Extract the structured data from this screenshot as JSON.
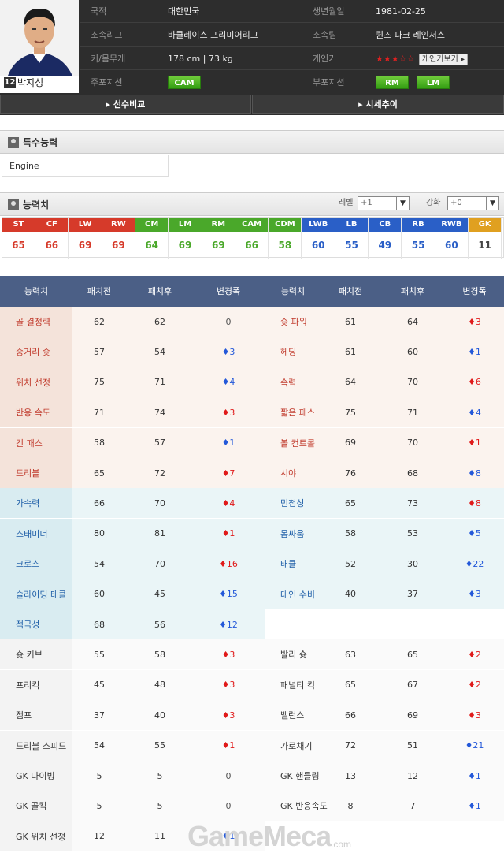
{
  "player": {
    "name": "박지성",
    "number": "12",
    "rows": [
      {
        "l1": "국적",
        "v1": "대한민국",
        "l2": "생년월일",
        "v2": "1981-02-25"
      },
      {
        "l1": "소속리그",
        "v1": "바클레이스 프리미어리그",
        "l2": "소속팀",
        "v2": "퀸즈 파크 레인저스"
      },
      {
        "l1": "키/몸무게",
        "v1": "178 cm | 73 kg",
        "l2": "개인기",
        "v2_stars": "★★★☆☆",
        "v2_btn": "개인기보기 ▸"
      },
      {
        "l1": "주포지션",
        "l2": "부포지션"
      }
    ],
    "main_positions": [
      "CAM"
    ],
    "sub_positions": [
      "RM",
      "LM"
    ]
  },
  "compare_bar": {
    "left": "▸ 선수비교",
    "right": "▸ 시세추이"
  },
  "special": {
    "title": "특수능력",
    "items": [
      "Engine"
    ]
  },
  "ability": {
    "title": "능력치",
    "level_label": "레벨",
    "level_value": "+1",
    "enhance_label": "강화",
    "enhance_value": "+0",
    "positions": [
      {
        "pos": "ST",
        "val": "65",
        "color": "#d63a2a"
      },
      {
        "pos": "CF",
        "val": "66",
        "color": "#d63a2a"
      },
      {
        "pos": "LW",
        "val": "69",
        "color": "#d63a2a"
      },
      {
        "pos": "RW",
        "val": "69",
        "color": "#d63a2a"
      },
      {
        "pos": "CM",
        "val": "64",
        "color": "#4aa82a"
      },
      {
        "pos": "LM",
        "val": "69",
        "color": "#4aa82a"
      },
      {
        "pos": "RM",
        "val": "69",
        "color": "#4aa82a"
      },
      {
        "pos": "CAM",
        "val": "66",
        "color": "#4aa82a"
      },
      {
        "pos": "CDM",
        "val": "58",
        "color": "#4aa82a"
      },
      {
        "pos": "LWB",
        "val": "60",
        "color": "#2a5fc7"
      },
      {
        "pos": "LB",
        "val": "55",
        "color": "#2a5fc7"
      },
      {
        "pos": "CB",
        "val": "49",
        "color": "#2a5fc7"
      },
      {
        "pos": "RB",
        "val": "55",
        "color": "#2a5fc7"
      },
      {
        "pos": "RWB",
        "val": "60",
        "color": "#2a5fc7"
      },
      {
        "pos": "GK",
        "val": "11",
        "color": "#e0a020"
      }
    ]
  },
  "stats": {
    "headers": [
      "능력치",
      "패치전",
      "패치후",
      "변경폭",
      "능력치",
      "패치전",
      "패치후",
      "변경폭"
    ],
    "rows": [
      {
        "g": "a",
        "n1": "골 결정력",
        "b1": "62",
        "a1": "62",
        "d1": "0",
        "n2": "슛 파워",
        "b2": "61",
        "a2": "64",
        "d2": "♦3"
      },
      {
        "g": "a",
        "n1": "중거리 슛",
        "b1": "57",
        "a1": "54",
        "d1": "♦3",
        "n2": "헤딩",
        "b2": "61",
        "a2": "60",
        "d2": "♦1"
      },
      {
        "g": "a",
        "n1": "위치 선정",
        "b1": "75",
        "a1": "71",
        "d1": "♦4",
        "n2": "속력",
        "b2": "64",
        "a2": "70",
        "d2": "♦6"
      },
      {
        "g": "a",
        "n1": "반응 속도",
        "b1": "71",
        "a1": "74",
        "d1": "♦3",
        "n2": "짧은 패스",
        "b2": "75",
        "a2": "71",
        "d2": "♦4"
      },
      {
        "g": "a",
        "n1": "긴 패스",
        "b1": "58",
        "a1": "57",
        "d1": "♦1",
        "n2": "볼 컨트롤",
        "b2": "69",
        "a2": "70",
        "d2": "♦1"
      },
      {
        "g": "a",
        "n1": "드리블",
        "b1": "65",
        "a1": "72",
        "d1": "♦7",
        "n2": "시야",
        "b2": "76",
        "a2": "68",
        "d2": "♦8"
      },
      {
        "g": "b",
        "n1": "가속력",
        "b1": "66",
        "a1": "70",
        "d1": "♦4",
        "n2": "민첩성",
        "b2": "65",
        "a2": "73",
        "d2": "♦8"
      },
      {
        "g": "b",
        "n1": "스태미너",
        "b1": "80",
        "a1": "81",
        "d1": "♦1",
        "n2": "몸싸움",
        "b2": "58",
        "a2": "53",
        "d2": "♦5"
      },
      {
        "g": "b",
        "n1": "크로스",
        "b1": "54",
        "a1": "70",
        "d1": "♦16",
        "n2": "태클",
        "b2": "52",
        "a2": "30",
        "d2": "♦22"
      },
      {
        "g": "b",
        "n1": "슬라이딩 태클",
        "b1": "60",
        "a1": "45",
        "d1": "♦15",
        "n2": "대인 수비",
        "b2": "40",
        "a2": "37",
        "d2": "♦3"
      },
      {
        "g": "b",
        "n1": "적극성",
        "b1": "68",
        "a1": "56",
        "d1": "♦12",
        "n2": "",
        "b2": "",
        "a2": "",
        "d2": ""
      },
      {
        "g": "c",
        "n1": "슛 커브",
        "b1": "55",
        "a1": "58",
        "d1": "♦3",
        "n2": "발리 슛",
        "b2": "63",
        "a2": "65",
        "d2": "♦2"
      },
      {
        "g": "c",
        "n1": "프리킥",
        "b1": "45",
        "a1": "48",
        "d1": "♦3",
        "n2": "패널티 킥",
        "b2": "65",
        "a2": "67",
        "d2": "♦2"
      },
      {
        "g": "c",
        "n1": "점프",
        "b1": "37",
        "a1": "40",
        "d1": "♦3",
        "n2": "밸런스",
        "b2": "66",
        "a2": "69",
        "d2": "♦3"
      },
      {
        "g": "c",
        "n1": "드리블 스피드",
        "b1": "54",
        "a1": "55",
        "d1": "♦1",
        "n2": "가로채기",
        "b2": "72",
        "a2": "51",
        "d2": "♦21"
      },
      {
        "g": "c",
        "n1": "GK 다이빙",
        "b1": "5",
        "a1": "5",
        "d1": "0",
        "n2": "GK 핸들링",
        "b2": "13",
        "a2": "12",
        "d2": "♦1"
      },
      {
        "g": "c",
        "n1": "GK 골킥",
        "b1": "5",
        "a1": "5",
        "d1": "0",
        "n2": "GK 반응속도",
        "b2": "8",
        "a2": "7",
        "d2": "♦1"
      },
      {
        "g": "c",
        "n1": "GK 위치 선정",
        "b1": "12",
        "a1": "11",
        "d1": "♦1",
        "n2": "",
        "b2": "",
        "a2": "",
        "d2": ""
      }
    ]
  },
  "watermark": {
    "text": "GameMeca",
    "suffix": ".com"
  }
}
